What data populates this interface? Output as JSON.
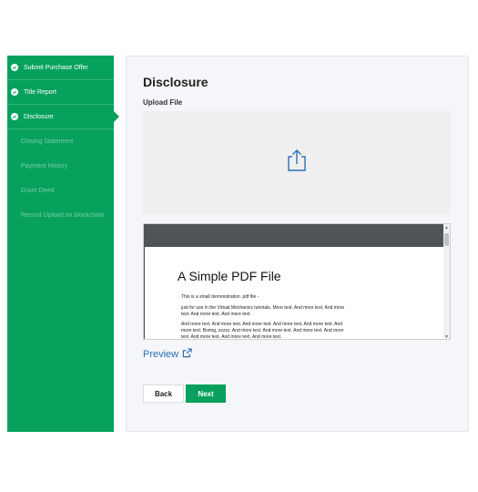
{
  "sidebar": {
    "steps": [
      {
        "label": "Submit Purchase Offer",
        "status": "done"
      },
      {
        "label": "Title Report",
        "status": "done"
      },
      {
        "label": "Disclosure",
        "status": "active"
      },
      {
        "label": "Closing Statement",
        "status": "todo"
      },
      {
        "label": "Payment History",
        "status": "todo"
      },
      {
        "label": "Grant Deed",
        "status": "todo"
      },
      {
        "label": "Record Upload on blockchain",
        "status": "todo"
      }
    ]
  },
  "main": {
    "title": "Disclosure",
    "upload_label": "Upload File",
    "upload_icon": "upload-icon",
    "pdf": {
      "heading": "A Simple PDF File",
      "line1": "This is a small demonstration .pdf file -",
      "line2": "just for use in the Virtual Mechanics tutorials. More text. And more text. And more text. And more text. And more text.",
      "line3": "And more text. And more text. And more text. And more text. And more text. And more text. Boring, zzzzz. And more text. And more text. And more text. And more text. And more text. And more text. And more text."
    },
    "preview_label": "Preview",
    "preview_icon": "external-link-icon",
    "back_label": "Back",
    "next_label": "Next"
  },
  "colors": {
    "accent": "#07a15d",
    "link": "#2f6fb5"
  }
}
